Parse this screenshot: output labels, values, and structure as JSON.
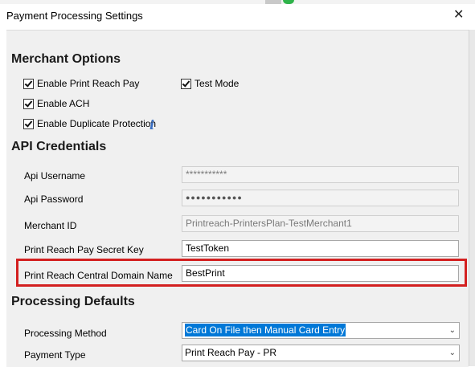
{
  "window": {
    "title": "Payment Processing Settings",
    "close_glyph": "✕"
  },
  "merchant_options": {
    "heading": "Merchant Options",
    "checkboxes": [
      {
        "label": "Enable Print Reach Pay",
        "checked": true
      },
      {
        "label": "Test Mode",
        "checked": true
      },
      {
        "label": "Enable ACH",
        "checked": true
      },
      {
        "label": "Enable Duplicate Protection",
        "checked": true
      }
    ],
    "info_glyph": "i"
  },
  "api_credentials": {
    "heading": "API Credentials",
    "fields": [
      {
        "label": "Api Username",
        "value": "***********",
        "disabled": true
      },
      {
        "label": "Api Password",
        "value": "●●●●●●●●●●●",
        "disabled": true
      },
      {
        "label": "Merchant ID",
        "value": "Printreach-PrintersPlan-TestMerchant1",
        "disabled": true
      },
      {
        "label": "Print Reach Pay Secret Key",
        "value": "TestToken",
        "disabled": false
      },
      {
        "label": "Print Reach Central Domain Name",
        "value": "BestPrint",
        "disabled": false
      }
    ]
  },
  "processing_defaults": {
    "heading": "Processing Defaults",
    "processing_method": {
      "label": "Processing Method",
      "value": "Card On File then Manual Card Entry"
    },
    "payment_type": {
      "label": "Payment Type",
      "value": "Print Reach Pay - PR"
    }
  },
  "colors": {
    "highlight": "#d32020",
    "selection": "#0078d7",
    "info_icon": "#3a6fc4"
  }
}
